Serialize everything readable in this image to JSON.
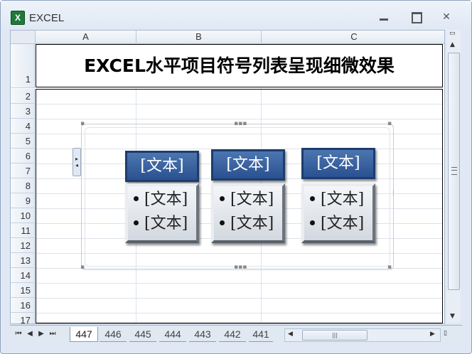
{
  "window": {
    "title": "EXCEL"
  },
  "columns": [
    "A",
    "B",
    "C"
  ],
  "rows": [
    "1",
    "2",
    "3",
    "4",
    "5",
    "6",
    "7",
    "8",
    "9",
    "10",
    "11",
    "12",
    "13",
    "14",
    "15",
    "16",
    "17"
  ],
  "cells": {
    "a1_title": "EXCEL水平项目符号列表呈现细微效果"
  },
  "smartart": {
    "items": [
      {
        "header": "[文本]",
        "bullets": [
          "[文本]",
          "[文本]"
        ]
      },
      {
        "header": "[文本]",
        "bullets": [
          "[文本]",
          "[文本]"
        ]
      },
      {
        "header": "[文本]",
        "bullets": [
          "[文本]",
          "[文本]"
        ]
      }
    ]
  },
  "sheet_tabs": [
    "447",
    "446",
    "445",
    "444",
    "443",
    "442",
    "441"
  ],
  "active_tab": "447"
}
